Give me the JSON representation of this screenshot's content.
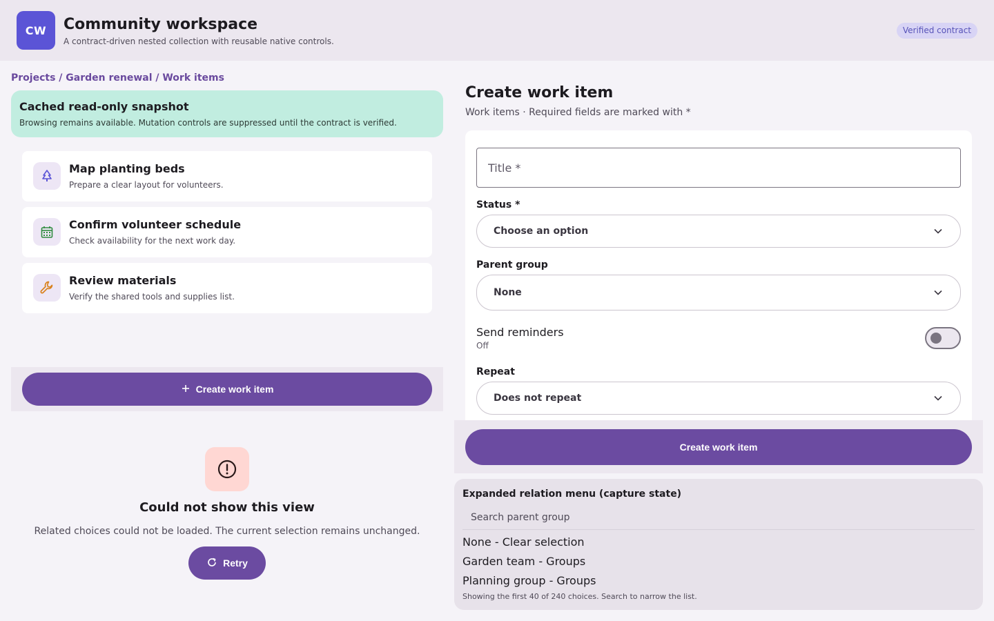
{
  "header": {
    "logo_text": "CW",
    "title": "Community workspace",
    "subtitle": "A contract-driven nested collection with reusable native controls.",
    "badge": "Verified contract"
  },
  "breadcrumb": "Projects / Garden renewal / Work items",
  "snapshot": {
    "title": "Cached read-only snapshot",
    "text": "Browsing remains available. Mutation controls are suppressed until the contract is verified."
  },
  "items": [
    {
      "title": "Map planting beds",
      "desc": "Prepare a clear layout for volunteers.",
      "icon": "tree-icon"
    },
    {
      "title": "Confirm volunteer schedule",
      "desc": "Check availability for the next work day.",
      "icon": "calendar-icon"
    },
    {
      "title": "Review materials",
      "desc": "Verify the shared tools and supplies list.",
      "icon": "wrench-icon"
    }
  ],
  "left_action": {
    "label": "Create work item"
  },
  "error": {
    "title": "Could not show this view",
    "text": "Related choices could not be loaded. The current selection remains unchanged.",
    "retry": "Retry"
  },
  "form": {
    "heading": "Create work item",
    "subheading": "Work items · Required fields are marked with *",
    "title_placeholder": "Title *",
    "status_label": "Status *",
    "status_value": "Choose an option",
    "parent_label": "Parent group",
    "parent_value": "None",
    "reminders_label": "Send reminders",
    "reminders_state": "Off",
    "repeat_label": "Repeat",
    "repeat_value": "Does not repeat",
    "submit": "Create work item"
  },
  "relation": {
    "title": "Expanded relation menu (capture state)",
    "search_placeholder": "Search parent group",
    "options": [
      "None - Clear selection",
      "Garden team - Groups",
      "Planning group - Groups"
    ],
    "footer": "Showing the first 40 of 240 choices. Search to narrow the list."
  },
  "colors": {
    "primary": "#6b4ba1",
    "logo": "#5b54d6",
    "snapshot": "#c1ede0",
    "error_bg": "#ffd7d3"
  }
}
